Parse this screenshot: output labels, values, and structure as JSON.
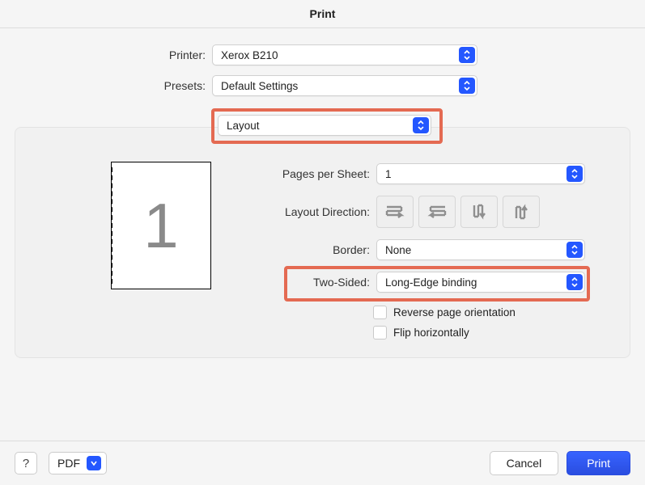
{
  "title": "Print",
  "top": {
    "printer_label": "Printer:",
    "printer_value": "Xerox B210",
    "presets_label": "Presets:",
    "presets_value": "Default Settings"
  },
  "panel_select": "Layout",
  "layout": {
    "preview_page_number": "1",
    "pages_per_sheet_label": "Pages per Sheet:",
    "pages_per_sheet_value": "1",
    "layout_direction_label": "Layout Direction:",
    "border_label": "Border:",
    "border_value": "None",
    "two_sided_label": "Two-Sided:",
    "two_sided_value": "Long-Edge binding",
    "reverse_label": "Reverse page orientation",
    "flip_label": "Flip horizontally"
  },
  "footer": {
    "help": "?",
    "pdf": "PDF",
    "cancel": "Cancel",
    "print": "Print"
  }
}
